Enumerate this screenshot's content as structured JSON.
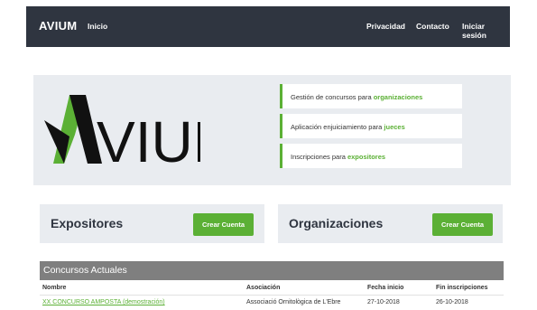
{
  "nav": {
    "brand": "AVIUM",
    "home": "Inicio",
    "privacy": "Privacidad",
    "contact": "Contacto",
    "login": "Iniciar sesión"
  },
  "hero": {
    "logo_text": "AVIUM",
    "features": [
      {
        "text": "Gestión de concursos para ",
        "highlight": "organizaciones"
      },
      {
        "text": "Aplicación enjuiciamiento para ",
        "highlight": "jueces"
      },
      {
        "text": "Inscripciones para ",
        "highlight": "expositores"
      }
    ]
  },
  "panels": {
    "exhibitors": {
      "title": "Expositores",
      "button": "Crear Cuenta"
    },
    "organizations": {
      "title": "Organizaciones",
      "button": "Crear Cuenta"
    }
  },
  "contests": {
    "title": "Concursos Actuales",
    "headers": [
      "Nombre",
      "Asociación",
      "Fecha inicio",
      "Fin inscripciones"
    ],
    "rows": [
      [
        "XX CONCURSO AMPOSTA (demostración)",
        "Associació Ornitològica de L'Ebre",
        "27-10-2018",
        "26-10-2018"
      ]
    ]
  },
  "colors": {
    "navbar": "#2f3540",
    "accent": "#5bb035",
    "panel_bg": "#e9ecf0",
    "table_header": "#7f7f7f"
  }
}
